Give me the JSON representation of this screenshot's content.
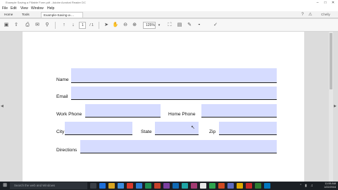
{
  "window": {
    "title": "Example Saving a Fillable Form.pdf - Adobe Acrobat Reader DC"
  },
  "menu": [
    "File",
    "Edit",
    "View",
    "Window",
    "Help"
  ],
  "tabs": {
    "home": "Home",
    "tools": "Tools",
    "document": "Example-Saving-a-..."
  },
  "user": "Chelly",
  "toolbar": {
    "page_current": "1",
    "page_total": "/ 1",
    "zoom": "125%"
  },
  "form": {
    "name_label": "Name",
    "email_label": "Email",
    "work_phone_label": "Work Phone",
    "home_phone_label": "Home Phone",
    "city_label": "City",
    "state_label": "State",
    "zip_label": "Zip",
    "directions_label": "Directions",
    "field_color": "#d6dcff"
  },
  "taskbar": {
    "search_placeholder": "Search the web and Windows",
    "time": "11:06 AM",
    "date": "1/22/2016"
  }
}
